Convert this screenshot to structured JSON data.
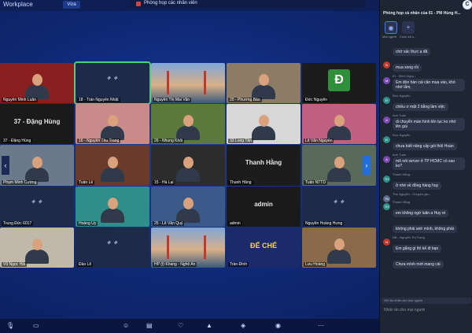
{
  "app": {
    "workspace": "Workplace",
    "mini_label": "Vừa"
  },
  "window": {
    "title": "Phòng họp các nhân viên"
  },
  "grid": {
    "tiles": [
      {
        "name": "Nguyễn Minh Luân",
        "kind": "person",
        "bg": "#8a1f1f"
      },
      {
        "name": "18 - Trần Nguyên Nhật",
        "kind": "eagle",
        "bg": "#1d2a4a",
        "active": true
      },
      {
        "name": "Nguyễn Thị Mai Vân",
        "kind": "sky",
        "bg": ""
      },
      {
        "name": "20 - Phương Bảo",
        "kind": "person",
        "bg": "#8c7c66"
      },
      {
        "name": "Đức Nguyễn",
        "kind": "d",
        "bg": "#1c1c1c",
        "letter": "Đ"
      },
      {
        "name": "37 - Đặng Hùng",
        "kind": "text",
        "bg": "#1a1a1a",
        "big": "37 - Đặng Hùng"
      },
      {
        "name": "16 - Nguyễn Thu Trang",
        "kind": "person",
        "bg": "#c98a8a"
      },
      {
        "name": "26 - Nhung Khôi",
        "kind": "person",
        "bg": "#5b7a3c"
      },
      {
        "name": "33 Long Tân",
        "kind": "person",
        "bg": "#d7d7d7"
      },
      {
        "name": "Lê Văn Nguyên",
        "kind": "person",
        "bg": "#c06080"
      },
      {
        "name": "Phạm Minh Cường",
        "kind": "person",
        "bg": "#6a7a8a"
      },
      {
        "name": "Tuấn Lê",
        "kind": "person",
        "bg": "#6a3a2a"
      },
      {
        "name": "15 - Hà Lại",
        "kind": "person",
        "bg": "#2c2c2c"
      },
      {
        "name": "Thanh Hằng",
        "kind": "text",
        "bg": "#1c1c1c",
        "big": "Thanh Hằng"
      },
      {
        "name": "Tuấn NTTD",
        "kind": "person",
        "bg": "#5a6a5a"
      },
      {
        "name": "Trung Đức 6017",
        "kind": "eagle",
        "bg": "#1d2a4a"
      },
      {
        "name": "Hoàng Uy",
        "kind": "person",
        "bg": "#2e8f8a"
      },
      {
        "name": "25 - Lê Văn Quý",
        "kind": "person",
        "bg": "#3a5a8a"
      },
      {
        "name": "admin",
        "kind": "text",
        "bg": "#1a1a1a",
        "big": "admin"
      },
      {
        "name": "Nguyễn Hoàng Hưng",
        "kind": "eagle",
        "bg": "#1d2a4a"
      },
      {
        "name": "Vũ Ngọc Hải",
        "kind": "person",
        "bg": "#c0b8a8"
      },
      {
        "name": "Đào Lê",
        "kind": "eagle",
        "bg": "#1d2a4a"
      },
      {
        "name": "HP (t) Khang - Nghệ An",
        "kind": "sky",
        "bg": ""
      },
      {
        "name": "Trần Đình",
        "kind": "poster",
        "bg": "#1a2a6a",
        "big": "ĐẾ CHẾ"
      },
      {
        "name": "Lưu Hoàng",
        "kind": "person",
        "bg": "#8a6a4a"
      }
    ]
  },
  "controls": {
    "nav_left": "‹",
    "nav_right": "›",
    "bottom": [
      "mic-icon",
      "camera-icon",
      "people-icon",
      "chat-icon",
      "reaction-icon",
      "share-icon",
      "security-icon",
      "record-icon",
      "more-icon"
    ]
  },
  "panel": {
    "header": "Phòng họp cá nhân của 01 - PM Hùng H...",
    "tabs": [
      {
        "label": "Mọi người",
        "icon": "◉"
      },
      {
        "label": "Cuộc trò c...",
        "icon": "+"
      }
    ],
    "messages": [
      {
        "sender": "",
        "text": "chờ xác thực ạ đã",
        "avatar_color": "#7a4ab0",
        "avatar": ""
      },
      {
        "sender": "",
        "text": "mua xong rồi",
        "avatar_color": "#c0392b",
        "avatar": "B"
      },
      {
        "sender": "01 - Minh Nguy...",
        "text": "Em đòn hàn cái cân mua vào, khó nhớ lắm,",
        "avatar_color": "#7a4ab0",
        "avatar": "M"
      },
      {
        "sender": "Đức Nguyễn",
        "text": "chiều ơ mặt 2 bằng làm việc",
        "avatar_color": "#2e8f8a",
        "avatar": "Đ"
      },
      {
        "sender": "Anh Tuấn",
        "text": "di chuyển màn hình lên tục ko nhớ lên gúi",
        "avatar_color": "#7a4ab0",
        "avatar": "A"
      },
      {
        "sender": "Đức Nguyễn",
        "text": "chưa biết nâng cấp gói thôi Hoàn",
        "avatar_color": "#2e8f8a",
        "avatar": "Đ"
      },
      {
        "sender": "Anh Tuấn",
        "text": "mô nói server ở TP HCMC có sao ko?",
        "avatar_color": "#7a4ab0",
        "avatar": "A"
      },
      {
        "sender": "Thanh Hằng",
        "text": "ở nhé về đồng hàng huy",
        "avatar_color": "#2e8f8a",
        "avatar": "TH"
      },
      {
        "sender": "Thu Nguyễn - Chuyên gia...",
        "text": "",
        "avatar_color": "#5a6a8a",
        "avatar": "TN"
      },
      {
        "sender": "Thanh Hằng",
        "text": "em không ngờ luân a Huy ơi",
        "avatar_color": "#2e8f8a",
        "avatar": "TH"
      },
      {
        "sender": "",
        "text": "không phải anh mình, không phải",
        "avatar_color": "#2e8f8a",
        "avatar": ""
      },
      {
        "sender": "NB - Nguyễn Thị Trang",
        "text": "Em gắng gì thì kế đi bạn",
        "avatar_color": "#c0392b",
        "avatar": "N"
      },
      {
        "sender": "",
        "text": "Chưa mình mới mang cái",
        "avatar_color": "#c0392b",
        "avatar": ""
      }
    ],
    "composer_hint": "Gửi tin nhắn cho mọi người",
    "input_placeholder": "Nhấn tin cho mọi người"
  },
  "corner_icon": "C"
}
